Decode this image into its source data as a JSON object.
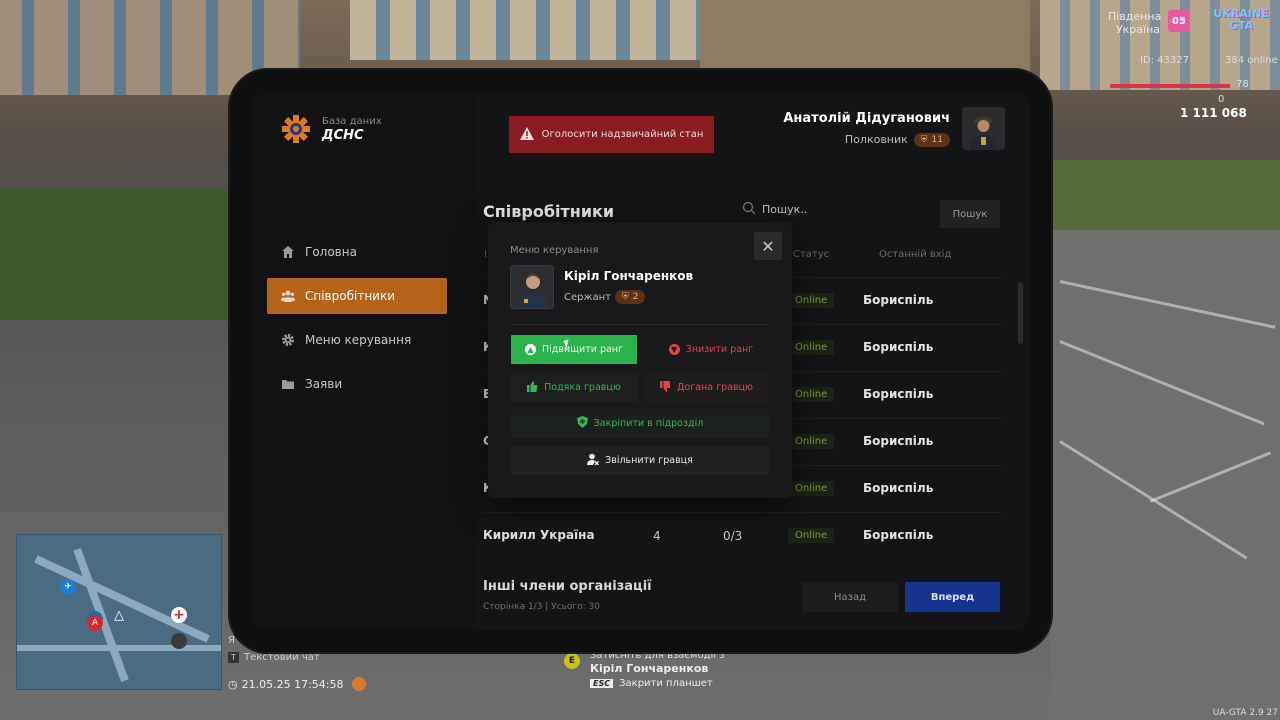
{
  "hud": {
    "region": "Південна Україна",
    "region_badge": "05",
    "logo": "UKRAINE GTA",
    "player_id": "ID: 43327",
    "online": "384 online",
    "health": "78",
    "armor": "0",
    "money": "1 111 068"
  },
  "tablet": {
    "brand": {
      "subtitle": "База даних",
      "name": "ДСНС"
    },
    "nav": [
      {
        "label": "Головна",
        "icon": "home-icon",
        "active": false
      },
      {
        "label": "Співробітники",
        "icon": "users-icon",
        "active": true
      },
      {
        "label": "Меню керування",
        "icon": "gear-icon",
        "active": false
      },
      {
        "label": "Заяви",
        "icon": "folder-icon",
        "active": false
      }
    ],
    "alert_button": "Оголосити надзвичайний стан",
    "user": {
      "name": "Анатолій Дідуганович",
      "rank": "Полковник",
      "rank_level": "11"
    },
    "page_title": "Співробітники",
    "search": {
      "placeholder": "Пошук..",
      "button": "Пошук"
    },
    "columns": {
      "first": "І",
      "status": "Статус",
      "last_login": "Останній вхід"
    },
    "rows": [
      {
        "name": "N",
        "level": "",
        "warns": "",
        "status": "Online",
        "city": "Бориспіль"
      },
      {
        "name": "К",
        "level": "",
        "warns": "",
        "status": "Online",
        "city": "Бориспіль"
      },
      {
        "name": "Е",
        "level": "",
        "warns": "",
        "status": "Online",
        "city": "Бориспіль"
      },
      {
        "name": "С",
        "level": "",
        "warns": "",
        "status": "Online",
        "city": "Бориспіль"
      },
      {
        "name": "К",
        "level": "",
        "warns": "",
        "status": "Online",
        "city": "Бориспіль"
      },
      {
        "name": "Кирилл Україна",
        "level": "4",
        "warns": "0/3",
        "status": "Online",
        "city": "Бориспіль"
      }
    ],
    "others_title": "Інші члени організації",
    "pager": "Сторінка 1/3 | Усього: 30",
    "back": "Назад",
    "next": "Вперед"
  },
  "modal": {
    "title": "Меню керування",
    "close": "✕",
    "member": {
      "name": "Кіріл Гончаренков",
      "rank": "Сержант",
      "rank_level": "2"
    },
    "actions": {
      "promote": "Підвищити ранг",
      "demote": "Знизити ранг",
      "thanks": "Подяка гравцю",
      "rebuke": "Догана гравцю",
      "assign": "Закріпити в підрозділ",
      "fire": "Звільнити гравця"
    },
    "colors": {
      "promote": "#2cb34a",
      "demote": "#e0474d"
    }
  },
  "chat": {
    "prefix": "Я",
    "label": "Текстовий чат",
    "key": "T",
    "datetime": "21.05.25 17:54:58"
  },
  "hint": {
    "key": "E",
    "line1": "Затисніть для взаємодії з",
    "target": "Кіріл Гончаренков",
    "esc_key": "ESC",
    "esc_label": "Закрити планшет"
  },
  "version": "UA-GTA 2.9   27"
}
